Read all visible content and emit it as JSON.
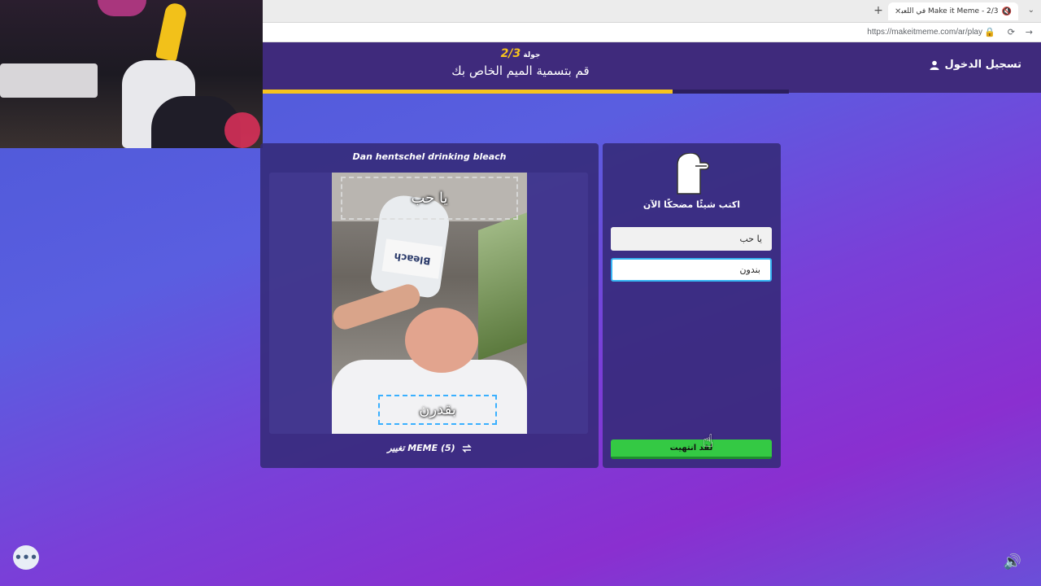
{
  "browser": {
    "tab_title": "Make it Meme - 2/3 في اللعبة",
    "new_tab": "+",
    "close": "✕",
    "url": "https://makeitmeme.com/ar/play"
  },
  "header": {
    "round_label": "جولة",
    "round_value": "2/3",
    "instruction": "قم بتسمية الميم الخاص بك",
    "login_label": "تسجيل الدخول",
    "progress": 0.78
  },
  "meme": {
    "name": "Dan hentschel drinking bleach",
    "caption_top": "يا حب",
    "caption_bottom": "بقدرن",
    "bottle_label": "Bleach",
    "change_label": "تغيير MEME (5)"
  },
  "caption_panel": {
    "prompt": "اكتب شيئًا مضحكًا الآن",
    "field_1_value": "يا حب",
    "field_2_value": "بندون",
    "done_label": "لقد انتهيت"
  },
  "icons": {
    "login": "user-icon",
    "change": "swap-icon",
    "chat": "chat-icon",
    "sound": "speaker-icon"
  },
  "colors": {
    "accent_yellow": "#f6c31e",
    "done_green": "#34c944",
    "focus_blue": "#36b4f2",
    "header_bg": "#3f2a7c"
  }
}
